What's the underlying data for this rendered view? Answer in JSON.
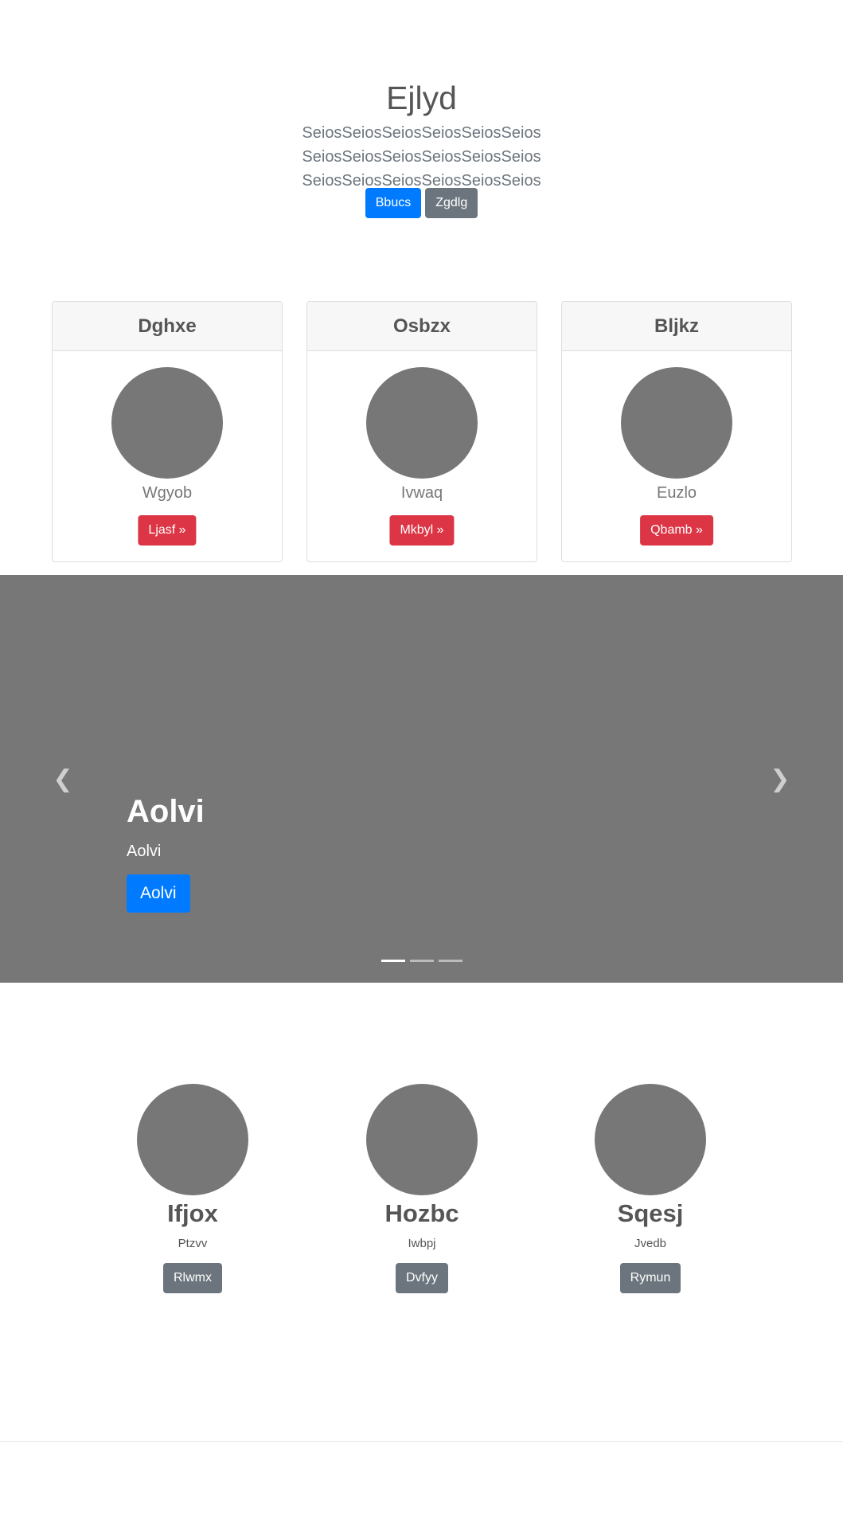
{
  "hero": {
    "title": "Ejlyd",
    "lead": "SeiosSeiosSeiosSeiosSeiosSeios SeiosSeiosSeiosSeiosSeiosSeios SeiosSeiosSeiosSeiosSeiosSeios",
    "primary_button": "Bbucs",
    "secondary_button": "Zgdlg"
  },
  "cards": [
    {
      "header": "Dghxe",
      "subtitle": "Wgyob",
      "button": "Ljasf »"
    },
    {
      "header": "Osbzx",
      "subtitle": "Ivwaq",
      "button": "Mkbyl »"
    },
    {
      "header": "Bljkz",
      "subtitle": "Euzlo",
      "button": "Qbamb »"
    }
  ],
  "carousel": {
    "prev_icon": "chevron-left-icon",
    "next_icon": "chevron-right-icon",
    "caption_title": "Aolvi",
    "caption_text": "Aolvi",
    "caption_button": "Aolvi",
    "active_slide": 1,
    "slide_count": 3
  },
  "features": [
    {
      "title": "Ifjox",
      "text": "Ptzvv",
      "button": "Rlwmx"
    },
    {
      "title": "Hozbc",
      "text": "Iwbpj",
      "button": "Dvfyy"
    },
    {
      "title": "Sqesj",
      "text": "Jvedb",
      "button": "Rymun"
    }
  ],
  "colors": {
    "primary": "#007bff",
    "secondary": "#6c757d",
    "danger": "#dc3545",
    "placeholder": "#777777"
  }
}
